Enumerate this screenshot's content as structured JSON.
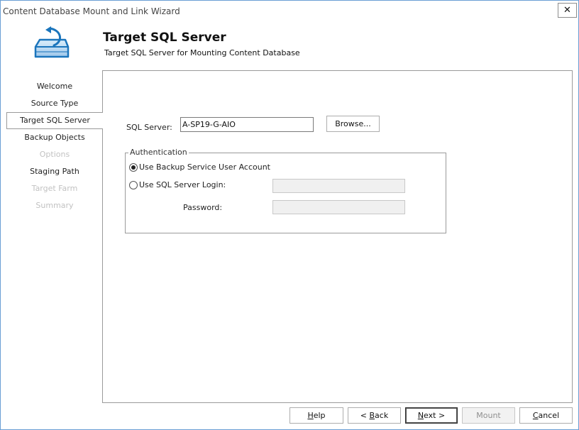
{
  "window": {
    "title": "Content Database Mount and Link Wizard",
    "close_glyph": "✕"
  },
  "header": {
    "title": "Target SQL Server",
    "subtitle": "Target SQL Server for Mounting Content Database",
    "icon": "database-mount-icon"
  },
  "nav": {
    "items": [
      {
        "label": "Welcome",
        "state": "normal"
      },
      {
        "label": "Source Type",
        "state": "normal"
      },
      {
        "label": "Target SQL Server",
        "state": "active"
      },
      {
        "label": "Backup Objects",
        "state": "normal"
      },
      {
        "label": "Options",
        "state": "disabled"
      },
      {
        "label": "Staging Path",
        "state": "normal"
      },
      {
        "label": "Target Farm",
        "state": "disabled"
      },
      {
        "label": "Summary",
        "state": "disabled"
      }
    ]
  },
  "form": {
    "sql_server_label": "SQL Server:",
    "sql_server_value": "A-SP19-G-AIO",
    "browse_label": "Browse...",
    "auth": {
      "legend": "Authentication",
      "option_backup_label": "Use Backup Service User Account",
      "option_sql_label": "Use SQL Server Login:",
      "selected": "backup",
      "login_value": "",
      "password_label": "Password:",
      "password_value": ""
    }
  },
  "footer": {
    "help": {
      "prefix": "",
      "accel": "H",
      "rest": "elp"
    },
    "back": {
      "prefix": "< ",
      "accel": "B",
      "rest": "ack"
    },
    "next": {
      "prefix": "",
      "accel": "N",
      "rest": "ext >"
    },
    "mount": {
      "label": "Mount"
    },
    "cancel": {
      "prefix": "",
      "accel": "C",
      "rest": "ancel"
    }
  },
  "colors": {
    "window_border": "#6a9fd4",
    "icon_blue": "#1b75bc",
    "disabled_text": "#c2c2c2"
  }
}
